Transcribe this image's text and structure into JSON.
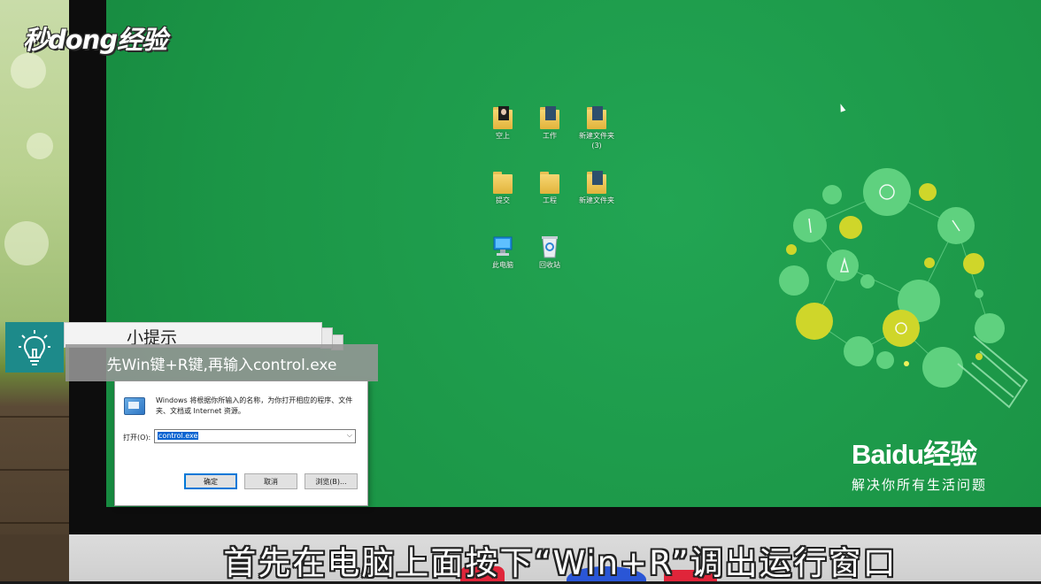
{
  "brand": {
    "logo_text": "秒dong经验",
    "baidu_brand": "Baidu经验",
    "baidu_slogan": "解决你所有生活问题"
  },
  "desktop": {
    "icons": [
      {
        "label": "空上",
        "type": "folder-dark"
      },
      {
        "label": "工作",
        "type": "folder-pic"
      },
      {
        "label": "新建文件夹\n(3)",
        "type": "folder-pic"
      },
      {
        "label": "提交",
        "type": "folder"
      },
      {
        "label": "工程",
        "type": "folder"
      },
      {
        "label": "新建文件夹",
        "type": "folder-pic"
      },
      {
        "label": "此电脑",
        "type": "computer-icon"
      },
      {
        "label": "回收站",
        "type": "recycle-bin-icon"
      }
    ]
  },
  "tip": {
    "title": "小提示",
    "text": "先Win键+R键,再输入control.exe"
  },
  "run_dialog": {
    "description": "Windows 将根据你所输入的名称，为你打开相应的程序、文件夹、文档或 Internet 资源。",
    "open_label": "打开(O):",
    "input_value": "control.exe",
    "ok_label": "确定",
    "cancel_label": "取消",
    "browse_label": "浏览(B)..."
  },
  "caption": {
    "text": "首先在电脑上面按下“Win+R”调出运行窗口"
  },
  "colors": {
    "desktop_green": "#1c9a48",
    "tip_teal": "#1d8a8a",
    "bulb_light": "#5fd17f",
    "bulb_yellow": "#cfd62a"
  }
}
